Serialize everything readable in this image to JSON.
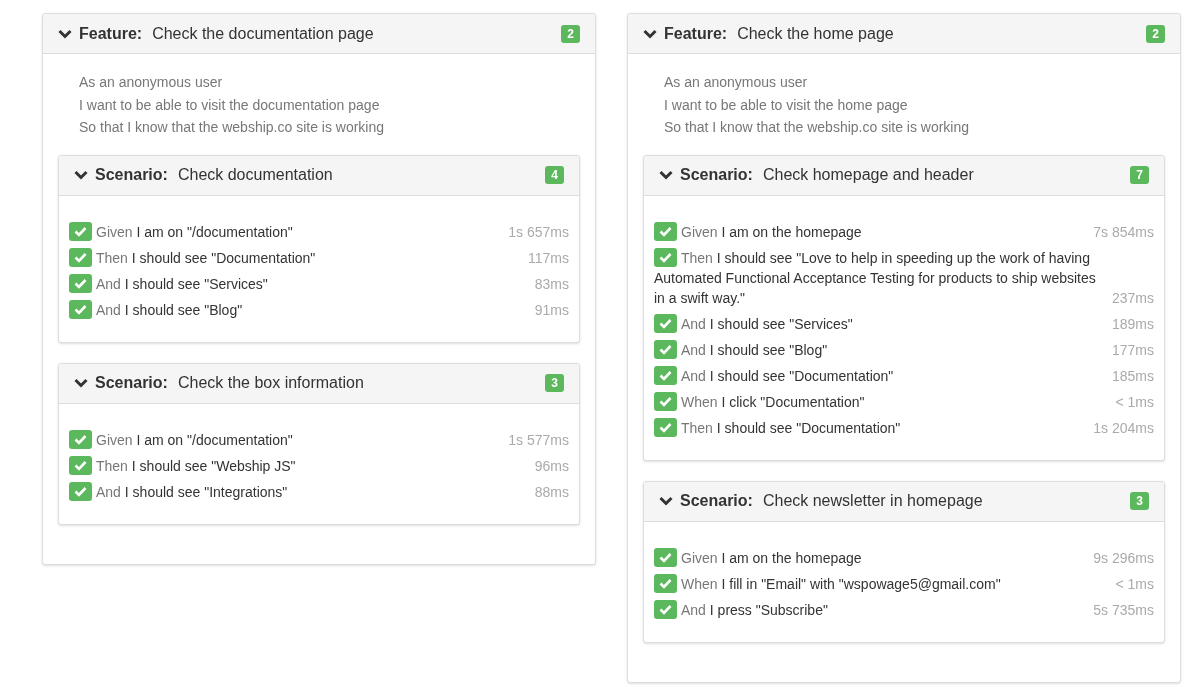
{
  "features": [
    {
      "keyword": "Feature:",
      "name": "Check the documentation page",
      "count": "2",
      "expanded": true,
      "description": [
        "As an anonymous user",
        "I want to be able to visit the documentation page",
        "So that I know that the webship.co site is working"
      ],
      "scenarios": [
        {
          "keyword": "Scenario:",
          "name": "Check documentation",
          "count": "4",
          "expanded": true,
          "steps": [
            {
              "keyword": "Given",
              "text": "I am on \"/documentation\"",
              "duration": "1s 657ms",
              "passed": true
            },
            {
              "keyword": "Then",
              "text": "I should see \"Documentation\"",
              "duration": "117ms",
              "passed": true
            },
            {
              "keyword": "And",
              "text": "I should see \"Services\"",
              "duration": "83ms",
              "passed": true
            },
            {
              "keyword": "And",
              "text": "I should see \"Blog\"",
              "duration": "91ms",
              "passed": true
            }
          ]
        },
        {
          "keyword": "Scenario:",
          "name": "Check the box information",
          "count": "3",
          "expanded": true,
          "steps": [
            {
              "keyword": "Given",
              "text": "I am on \"/documentation\"",
              "duration": "1s 577ms",
              "passed": true
            },
            {
              "keyword": "Then",
              "text": "I should see \"Webship JS\"",
              "duration": "96ms",
              "passed": true
            },
            {
              "keyword": "And",
              "text": "I should see \"Integrations\"",
              "duration": "88ms",
              "passed": true
            }
          ]
        }
      ]
    },
    {
      "keyword": "Feature:",
      "name": "Check the home page",
      "count": "2",
      "expanded": true,
      "description": [
        "As an anonymous user",
        "I want to be able to visit the home page",
        "So that I know that the webship.co site is working"
      ],
      "scenarios": [
        {
          "keyword": "Scenario:",
          "name": "Check homepage and header",
          "count": "7",
          "expanded": true,
          "steps": [
            {
              "keyword": "Given",
              "text": "I am on the homepage",
              "duration": "7s 854ms",
              "passed": true
            },
            {
              "keyword": "Then",
              "text": "I should see \"Love to help in speeding up the work of having Automated Functional Acceptance Testing for products to ship websites in a swift way.\"",
              "duration": "237ms",
              "passed": true
            },
            {
              "keyword": "And",
              "text": "I should see \"Services\"",
              "duration": "189ms",
              "passed": true
            },
            {
              "keyword": "And",
              "text": "I should see \"Blog\"",
              "duration": "177ms",
              "passed": true
            },
            {
              "keyword": "And",
              "text": "I should see \"Documentation\"",
              "duration": "185ms",
              "passed": true
            },
            {
              "keyword": "When",
              "text": "I click \"Documentation\"",
              "duration": "< 1ms",
              "passed": true
            },
            {
              "keyword": "Then",
              "text": "I should see \"Documentation\"",
              "duration": "1s 204ms",
              "passed": true
            }
          ]
        },
        {
          "keyword": "Scenario:",
          "name": "Check newsletter in homepage",
          "count": "3",
          "expanded": true,
          "steps": [
            {
              "keyword": "Given",
              "text": "I am on the homepage",
              "duration": "9s 296ms",
              "passed": true
            },
            {
              "keyword": "When",
              "text": "I fill in \"Email\" with \"wspowage5@gmail.com\"",
              "duration": "< 1ms",
              "passed": true
            },
            {
              "keyword": "And",
              "text": "I press \"Subscribe\"",
              "duration": "5s 735ms",
              "passed": true
            }
          ]
        }
      ]
    }
  ]
}
